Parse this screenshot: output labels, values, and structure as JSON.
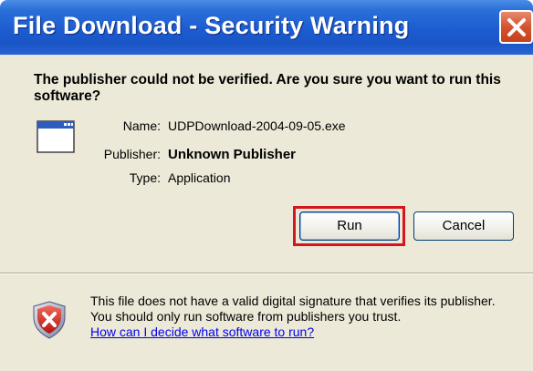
{
  "window": {
    "title": "File Download - Security Warning"
  },
  "dialog": {
    "question": "The publisher could not be verified.  Are you sure you want to run this software?",
    "file": {
      "name_label": "Name:",
      "name_value": "UDPDownload-2004-09-05.exe",
      "publisher_label": "Publisher:",
      "publisher_value": "Unknown Publisher",
      "type_label": "Type:",
      "type_value": "Application"
    },
    "buttons": {
      "run_label": "Run",
      "cancel_label": "Cancel"
    },
    "warning": {
      "text": "This file does not have a valid digital signature that verifies its publisher.  You should only run software from publishers you trust.",
      "link_text": "How can I decide what software to run?"
    }
  },
  "colors": {
    "titlebar": "#1c5cd0",
    "dialog_background": "#ece9d8",
    "highlight_border": "#d3161f",
    "link": "#0000ee"
  },
  "icons": {
    "close": "close-icon",
    "file": "application-window-icon",
    "shield": "security-shield-icon"
  }
}
